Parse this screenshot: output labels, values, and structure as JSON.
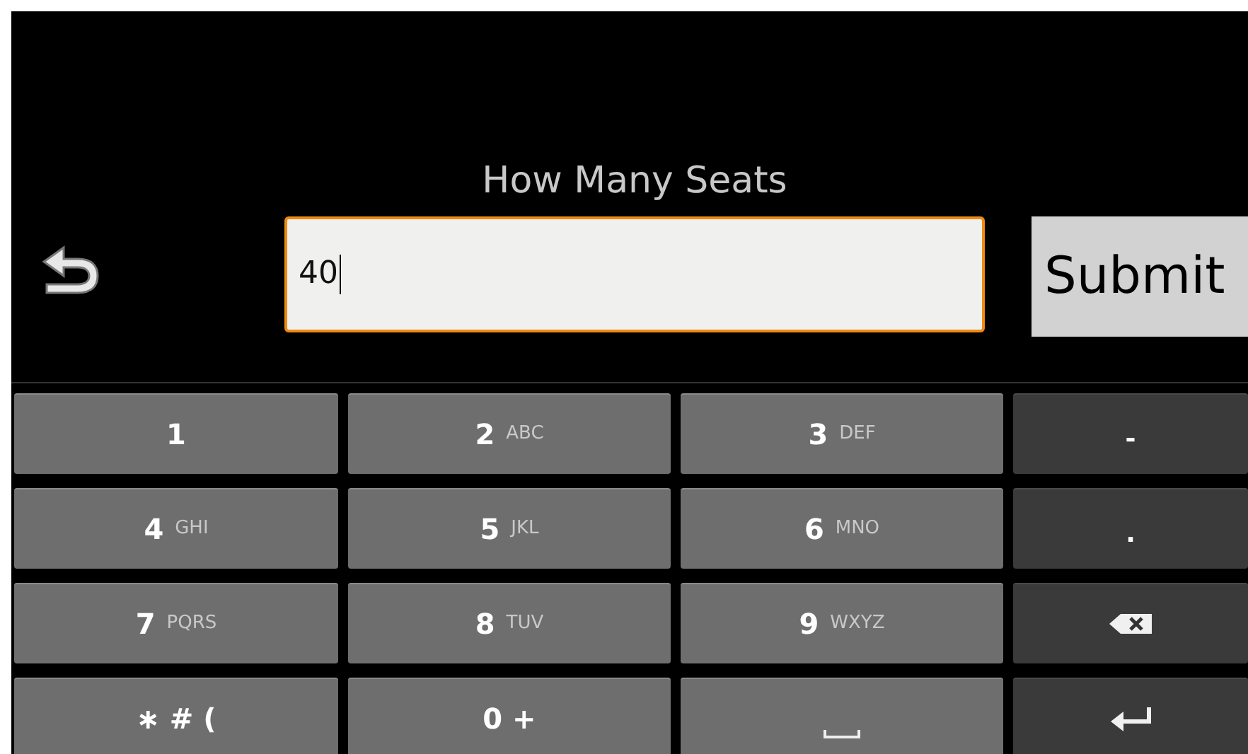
{
  "prompt": {
    "title": "How Many Seats",
    "value": "40"
  },
  "submit": {
    "label": "Submit"
  },
  "keys": [
    {
      "kind": "digit",
      "main": "1"
    },
    {
      "kind": "digit",
      "main": "2",
      "sub": "ABC"
    },
    {
      "kind": "digit",
      "main": "3",
      "sub": "DEF"
    },
    {
      "kind": "symbol",
      "main": "-"
    },
    {
      "kind": "digit",
      "main": "4",
      "sub": "GHI"
    },
    {
      "kind": "digit",
      "main": "5",
      "sub": "JKL"
    },
    {
      "kind": "digit",
      "main": "6",
      "sub": "MNO"
    },
    {
      "kind": "symbol",
      "main": "."
    },
    {
      "kind": "digit",
      "main": "7",
      "sub": "PQRS"
    },
    {
      "kind": "digit",
      "main": "8",
      "sub": "TUV"
    },
    {
      "kind": "digit",
      "main": "9",
      "sub": "WXYZ"
    },
    {
      "kind": "backspace"
    },
    {
      "kind": "digit",
      "main": "∗ # ("
    },
    {
      "kind": "digit",
      "main": "0 +"
    },
    {
      "kind": "space"
    },
    {
      "kind": "enter"
    }
  ]
}
